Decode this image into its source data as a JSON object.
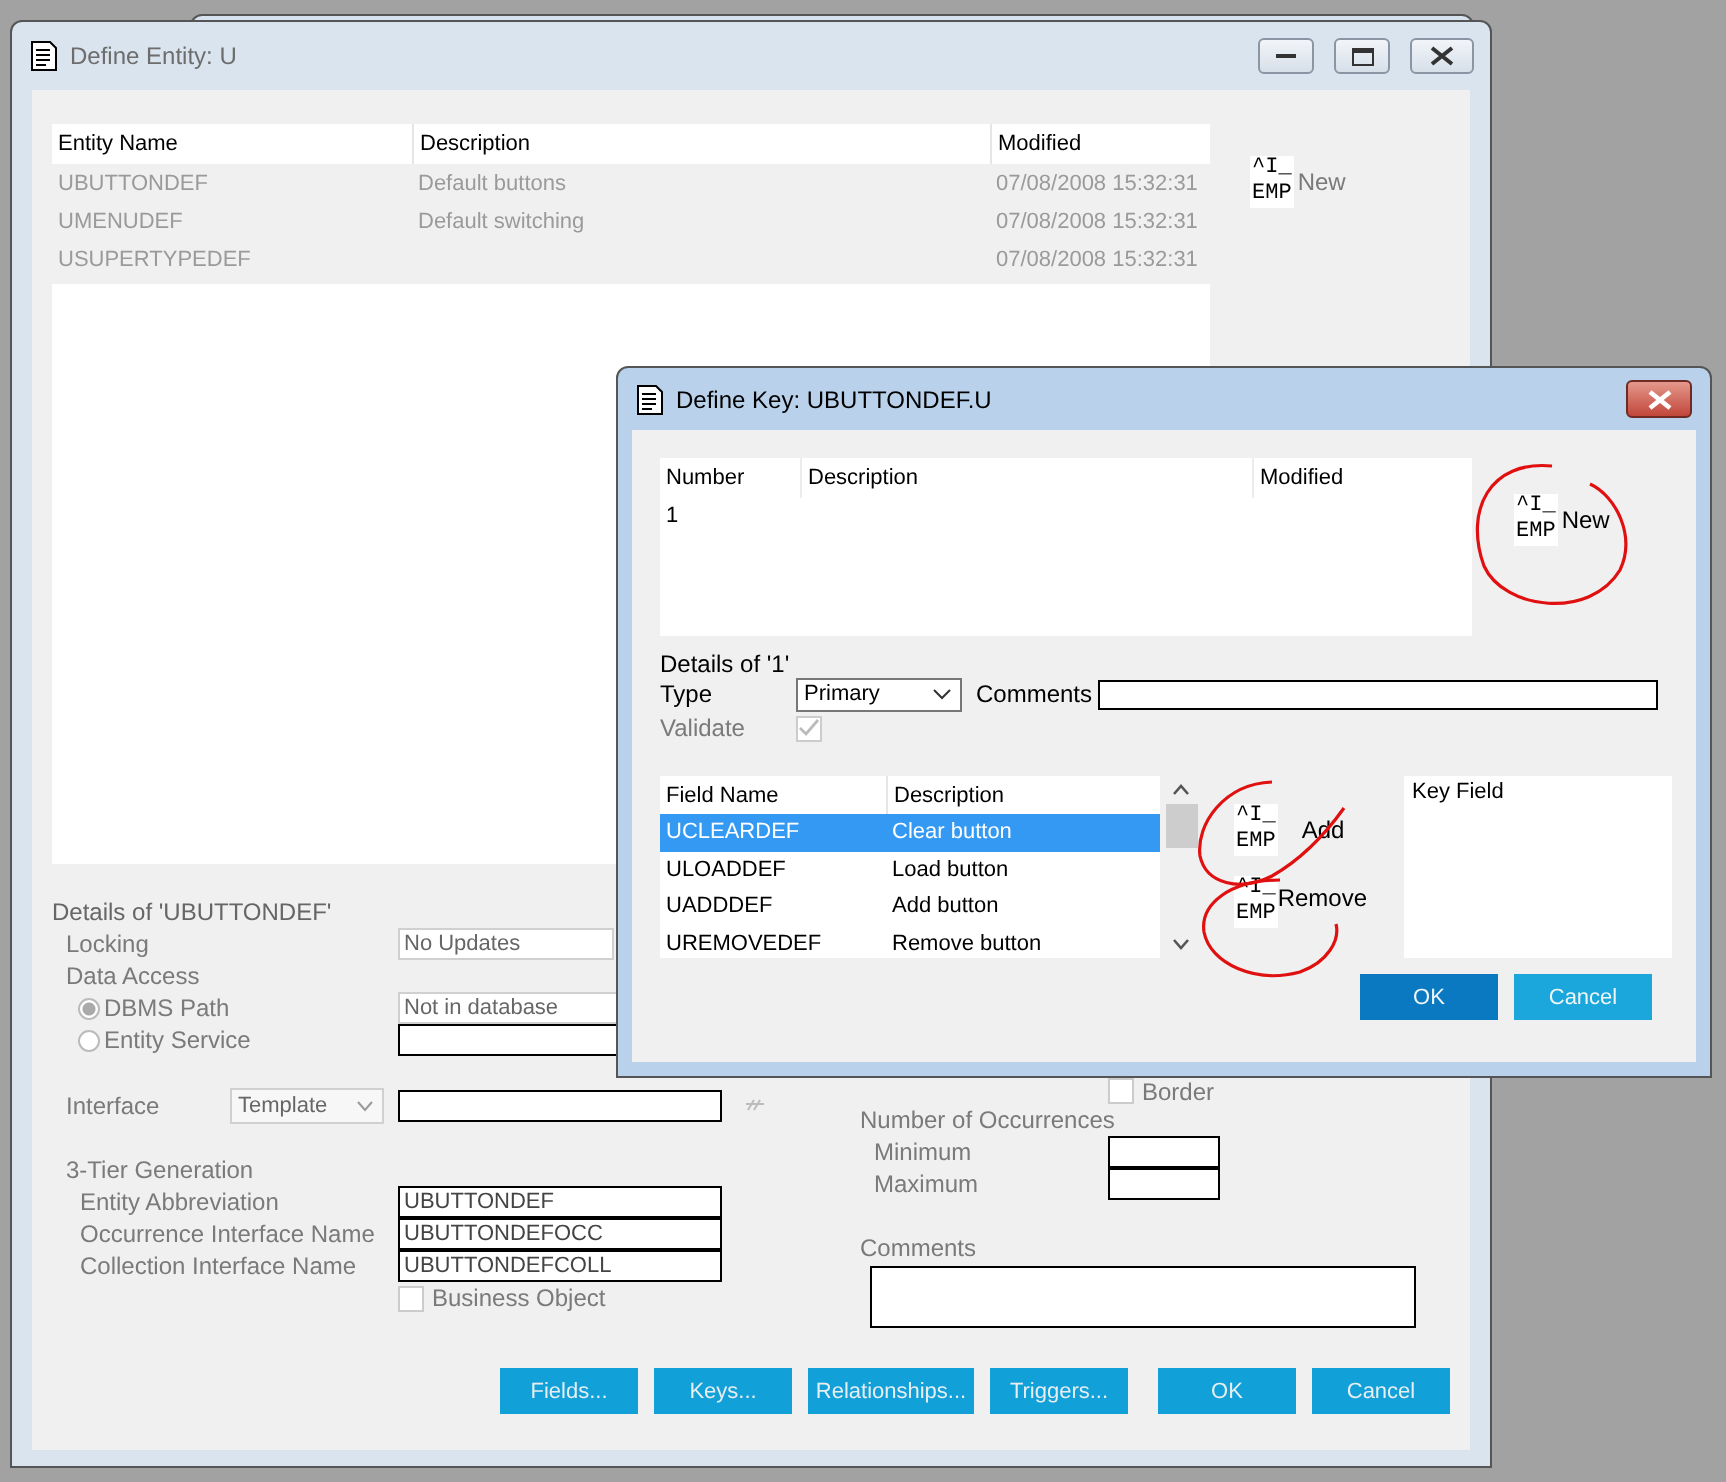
{
  "entity_window": {
    "title": "Define Entity: U",
    "table": {
      "columns": [
        "Entity Name",
        "Description",
        "Modified"
      ],
      "rows": [
        [
          "UBUTTONDEF",
          "Default buttons",
          "07/08/2008 15:32:31"
        ],
        [
          "UMENUDEF",
          "Default switching",
          "07/08/2008 15:32:31"
        ],
        [
          "USUPERTYPEDEF",
          "",
          "07/08/2008 15:32:31"
        ]
      ]
    },
    "new_tool": {
      "image_text": [
        "^I_",
        "EMP"
      ],
      "label": "New"
    },
    "details": {
      "title": "Details of 'UBUTTONDEF'",
      "locking": {
        "label": "Locking",
        "value": "No Updates"
      },
      "data_access": {
        "label": "Data Access",
        "options": [
          {
            "label": "DBMS Path",
            "selected": true,
            "value": "Not in database"
          },
          {
            "label": "Entity Service",
            "selected": false
          }
        ]
      },
      "interface": {
        "label": "Interface",
        "type": "Template"
      },
      "tier": {
        "title": "3-Tier Generation",
        "fields": [
          {
            "label": "Entity Abbreviation",
            "value": "UBUTTONDEF"
          },
          {
            "label": "Occurrence Interface Name",
            "value": "UBUTTONDEFOCC"
          },
          {
            "label": "Collection Interface Name",
            "value": "UBUTTONDEFCOLL"
          }
        ],
        "business_object": {
          "label": "Business Object",
          "checked": false
        }
      },
      "border": {
        "label": "Border",
        "checked": false
      },
      "occurrences": {
        "title": "Number of Occurrences",
        "fields": [
          "Minimum",
          "Maximum"
        ]
      },
      "comments_label": "Comments"
    },
    "buttons": [
      "Fields...",
      "Keys...",
      "Relationships...",
      "Triggers...",
      "OK",
      "Cancel"
    ]
  },
  "key_dialog": {
    "title": "Define Key: UBUTTONDEF.U",
    "table": {
      "columns": [
        "Number",
        "Description",
        "Modified"
      ],
      "rows": [
        [
          "1",
          "",
          ""
        ]
      ]
    },
    "new_tool": {
      "image_text": [
        "^I_",
        "EMP"
      ],
      "label": "New"
    },
    "details_title": "Details of '1'",
    "type": {
      "label": "Type",
      "value": "Primary"
    },
    "comments": {
      "label": "Comments"
    },
    "validate": {
      "label": "Validate",
      "checked": true
    },
    "fields": {
      "columns": [
        "Field Name",
        "Description"
      ],
      "rows": [
        {
          "name": "UCLEARDEF",
          "description": "Clear button",
          "selected": true
        },
        {
          "name": "ULOADDEF",
          "description": "Load button",
          "selected": false
        },
        {
          "name": "UADDDEF",
          "description": "Add button",
          "selected": false
        },
        {
          "name": "UREMOVEDEF",
          "description": "Remove button",
          "selected": false
        }
      ]
    },
    "tools": [
      {
        "image_text": [
          "^I_",
          "EMP"
        ],
        "label": "Add"
      },
      {
        "image_text": [
          "^I_",
          "EMP"
        ],
        "label": "Remove"
      }
    ],
    "key_field": {
      "title": "Key Field"
    },
    "buttons": [
      {
        "label": "OK",
        "default": true
      },
      {
        "label": "Cancel",
        "default": false
      }
    ]
  }
}
